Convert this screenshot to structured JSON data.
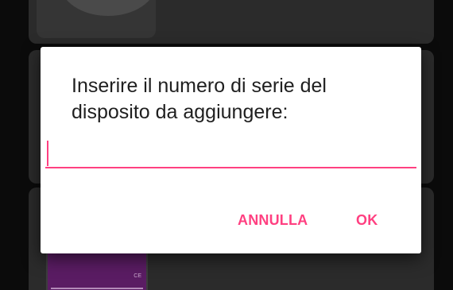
{
  "dialog": {
    "message": "Inserire il numero di serie del disposito da aggiungere:",
    "serial_input": {
      "value": "",
      "placeholder": ""
    },
    "cancel_label": "ANNULLA",
    "ok_label": "OK"
  },
  "background": {
    "device_mark": "CE"
  },
  "colors": {
    "accent": "#ff4081",
    "dialog_background": "#ffffff",
    "overlay_background": "#0b0b0b",
    "card_background": "#2b2b2b",
    "device_color": "#5a1c63"
  }
}
